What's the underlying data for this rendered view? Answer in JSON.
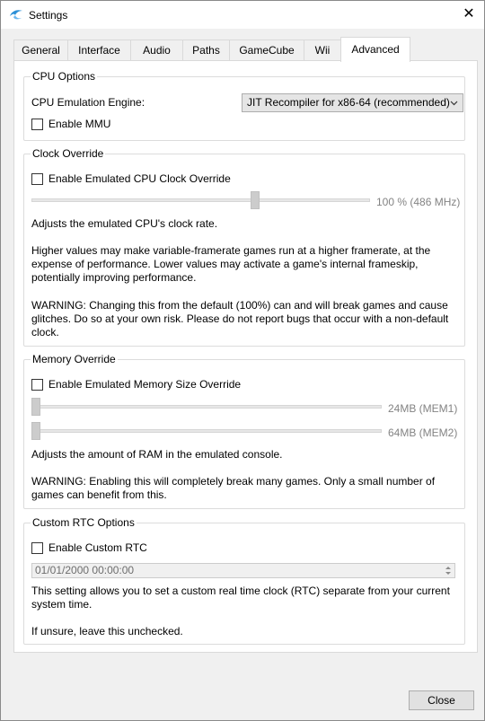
{
  "window": {
    "title": "Settings",
    "close_glyph": "✕",
    "icon": "dolphin-icon"
  },
  "tabs": [
    {
      "label": "General"
    },
    {
      "label": "Interface"
    },
    {
      "label": "Audio"
    },
    {
      "label": "Paths"
    },
    {
      "label": "GameCube"
    },
    {
      "label": "Wii"
    },
    {
      "label": "Advanced",
      "selected": true
    }
  ],
  "cpu": {
    "title": "CPU Options",
    "engine_label": "CPU Emulation Engine:",
    "engine_value": "JIT Recompiler for x86-64 (recommended)",
    "mmu_label": "Enable MMU",
    "mmu_checked": false
  },
  "clock": {
    "title": "Clock Override",
    "enable_label": "Enable Emulated CPU Clock Override",
    "enable_checked": false,
    "slider_value": "100 % (486 MHz)",
    "slider_fraction": 0.67,
    "desc1": "Adjusts the emulated CPU's clock rate.",
    "desc2": "Higher values may make variable-framerate games run at a higher framerate, at the expense of performance. Lower values may activate a game's internal frameskip, potentially improving performance.",
    "desc3": "WARNING: Changing this from the default (100%) can and will break games and cause glitches. Do so at your own risk. Please do not report bugs that occur with a non-default clock."
  },
  "memory": {
    "title": "Memory Override",
    "enable_label": "Enable Emulated Memory Size Override",
    "enable_checked": false,
    "mem1_value": "24MB (MEM1)",
    "mem2_value": "64MB (MEM2)",
    "mem1_fraction": 0,
    "mem2_fraction": 0,
    "desc1": "Adjusts the amount of RAM in the emulated console.",
    "desc2": "WARNING: Enabling this will completely break many games. Only a small number of games can benefit from this."
  },
  "rtc": {
    "title": "Custom RTC Options",
    "enable_label": "Enable Custom RTC",
    "enable_checked": false,
    "datetime_value": "01/01/2000 00:00:00",
    "desc1": "This setting allows you to set a custom real time clock (RTC) separate from your current system time.",
    "desc2": "If unsure, leave this unchecked."
  },
  "footer": {
    "close_label": "Close"
  }
}
